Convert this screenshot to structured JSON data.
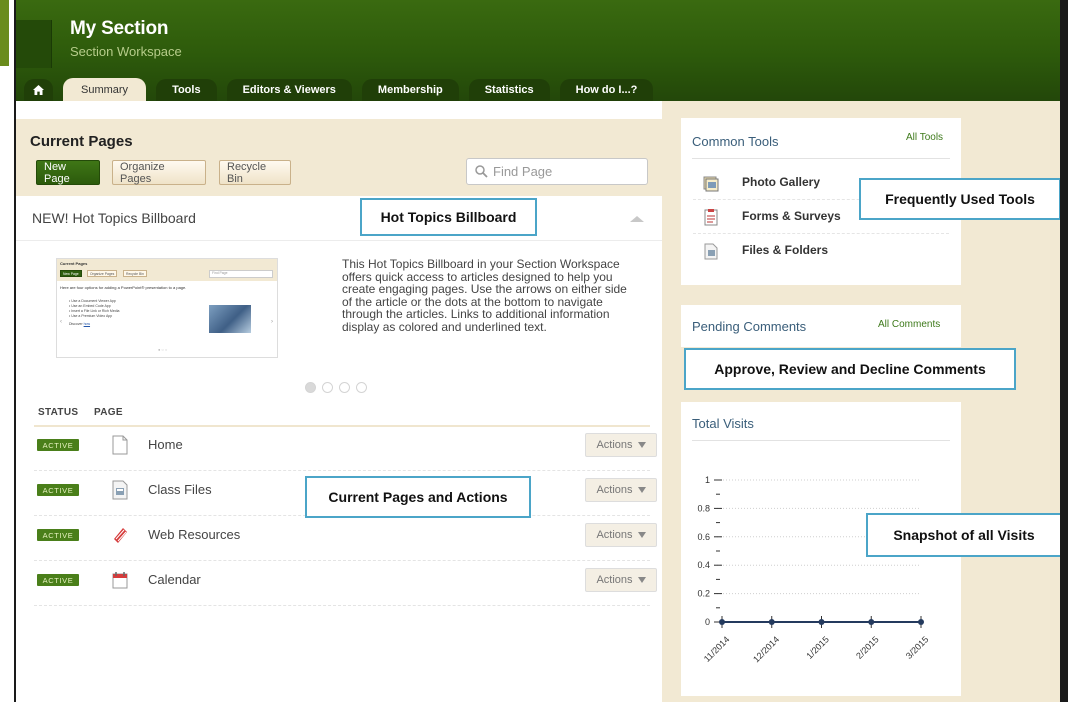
{
  "header": {
    "title": "My Section",
    "subtitle": "Section Workspace"
  },
  "tabs": [
    {
      "label": "Summary",
      "active": true
    },
    {
      "label": "Tools"
    },
    {
      "label": "Editors & Viewers"
    },
    {
      "label": "Membership"
    },
    {
      "label": "Statistics"
    },
    {
      "label": "How do I...?"
    }
  ],
  "current_pages": {
    "title": "Current Pages",
    "new_page": "New Page",
    "organize_pages": "Organize Pages",
    "recycle_bin": "Recycle Bin",
    "find_placeholder": "Find Page"
  },
  "billboard": {
    "title": "NEW! Hot Topics Billboard",
    "description": "This Hot Topics Billboard in your Section Workspace offers quick access to articles designed  to help you create engaging pages. Use the arrows on either side of the article or the dots at the bottom to navigate through the articles. Links to additional information display as colored and underlined text.",
    "thumb": {
      "title": "Current Pages",
      "new_page": "New Page",
      "organize": "Organize Pages",
      "recycle": "Recycle Bin",
      "find": "Find Page",
      "intro": "Here are four options for adding a PowerPoint® presentation to a page.",
      "list": [
        "• Use a Document Viewer App",
        "• Use an Embed Code App",
        "• Insert a File Link or Rich Media",
        "• Use a Premium Video App"
      ],
      "discover": "Discover",
      "discover_link": "how"
    }
  },
  "table": {
    "status_header": "STATUS",
    "page_header": "PAGE",
    "rows": [
      {
        "status": "ACTIVE",
        "name": "Home",
        "icon": "page-icon",
        "actions": "Actions"
      },
      {
        "status": "ACTIVE",
        "name": "Class Files",
        "icon": "class-files-icon",
        "actions": "Actions"
      },
      {
        "status": "ACTIVE",
        "name": "Web Resources",
        "icon": "web-resources-icon",
        "actions": "Actions"
      },
      {
        "status": "ACTIVE",
        "name": "Calendar",
        "icon": "calendar-icon",
        "actions": "Actions"
      }
    ]
  },
  "common_tools": {
    "title": "Common Tools",
    "link": "All Tools",
    "items": [
      {
        "name": "Photo Gallery",
        "icon": "photo-gallery-icon"
      },
      {
        "name": "Forms & Surveys",
        "icon": "forms-surveys-icon"
      },
      {
        "name": "Files & Folders",
        "icon": "files-folders-icon"
      }
    ]
  },
  "pending_comments": {
    "title": "Pending Comments",
    "link": "All Comments"
  },
  "total_visits": {
    "title": "Total Visits"
  },
  "chart_data": {
    "type": "line",
    "title": "Total Visits",
    "categories": [
      "11/2014",
      "12/2014",
      "1/2015",
      "2/2015",
      "3/2015"
    ],
    "values": [
      0,
      0,
      0,
      0,
      0
    ],
    "yticks": [
      "1",
      "0.8",
      "0.6",
      "0.4",
      "0.2",
      "0"
    ],
    "ylim": [
      0,
      1
    ],
    "grid": true,
    "line_color": "#243a5e"
  },
  "callouts": {
    "hot_topics": "Hot Topics Billboard",
    "frequently_used": "Frequently Used Tools",
    "approve": "Approve, Review and Decline Comments",
    "current_pages": "Current Pages and Actions",
    "snapshot": "Snapshot of all Visits"
  },
  "colors": {
    "header_green": "#2d5a0b",
    "accent_green": "#4a7f1a",
    "beige": "#f2e9d3",
    "callout_border": "#4ba5c8"
  }
}
